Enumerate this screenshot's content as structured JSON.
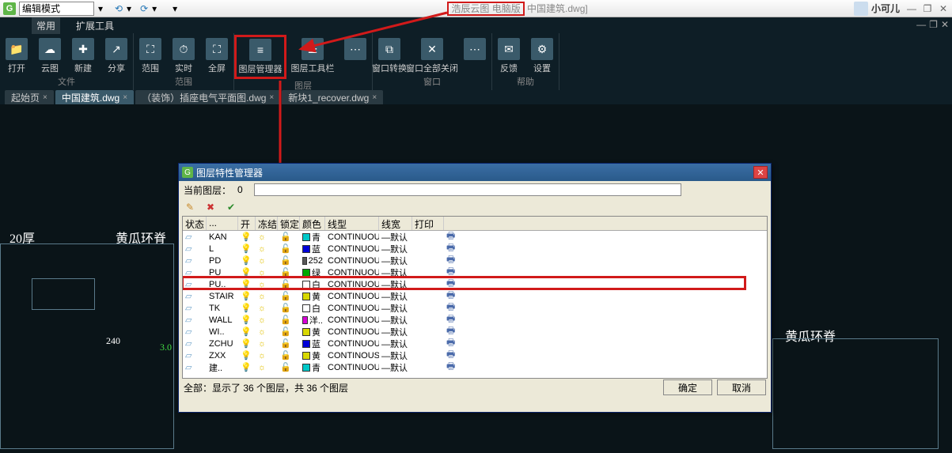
{
  "title": {
    "mode": "编辑模式",
    "center_highlight": "浩辰云图 电脑版",
    "center_suffix": "中国建筑.dwg]",
    "user": "小可儿"
  },
  "menu": {
    "items": [
      "常用",
      "扩展工具"
    ]
  },
  "ribbon": {
    "groups": [
      {
        "label": "文件",
        "buttons": [
          {
            "k": "open",
            "t": "打开"
          },
          {
            "k": "cloud",
            "t": "云图"
          },
          {
            "k": "new",
            "t": "新建"
          },
          {
            "k": "share",
            "t": "分享"
          }
        ]
      },
      {
        "label": "范围",
        "buttons": [
          {
            "k": "extent",
            "t": "范围"
          },
          {
            "k": "realtime",
            "t": "实时"
          },
          {
            "k": "full",
            "t": "全屏"
          }
        ]
      },
      {
        "label": "图层",
        "buttons": [
          {
            "k": "layermgr",
            "t": "图层管理器",
            "hl": true
          },
          {
            "k": "layertool",
            "t": "图层工具栏"
          },
          {
            "k": "layermisc",
            "t": ""
          }
        ]
      },
      {
        "label": "窗口",
        "buttons": [
          {
            "k": "winswitch",
            "t": "窗口转换"
          },
          {
            "k": "winclose",
            "t": "窗口全部关闭"
          },
          {
            "k": "winmisc",
            "t": ""
          }
        ]
      },
      {
        "label": "帮助",
        "buttons": [
          {
            "k": "feedback",
            "t": "反馈"
          },
          {
            "k": "settings",
            "t": "设置"
          }
        ]
      }
    ]
  },
  "tabs": [
    {
      "t": "起始页",
      "active": false
    },
    {
      "t": "中国建筑.dwg",
      "active": true
    },
    {
      "t": "（装饰）插座电气平面图.dwg",
      "active": false
    },
    {
      "t": "新块1_recover.dwg",
      "active": false
    }
  ],
  "drawing": {
    "t1": "20厚",
    "t2": "黄瓜环脊",
    "t3": "240",
    "t4": "3.0",
    "t5": "黄瓜环脊"
  },
  "dialog": {
    "title": "图层特性管理器",
    "current_label": "当前图层：",
    "current_value": "0",
    "headers": {
      "status": "状态",
      "name": "...",
      "on": "开",
      "freeze": "冻结",
      "lock": "锁定",
      "color": "颜色",
      "ltype": "线型",
      "lwt": "线宽",
      "plot": "打印"
    },
    "rows": [
      {
        "n": "KAN",
        "c": "青",
        "ch": "#00c8c8",
        "lt": "CONTINUOUS",
        "lw": "—默认"
      },
      {
        "n": "L",
        "c": "蓝",
        "ch": "#0000d8",
        "lt": "CONTINUOUS",
        "lw": "—默认"
      },
      {
        "n": "PD",
        "c": "252",
        "ch": "#585858",
        "lt": "CONTINUOUS",
        "lw": "—默认"
      },
      {
        "n": "PU",
        "c": "绿",
        "ch": "#00a800",
        "lt": "CONTINUOUS",
        "lw": "—默认"
      },
      {
        "n": "PU..",
        "c": "白",
        "ch": "#ffffff",
        "lt": "CONTINUOUS",
        "lw": "—默认",
        "hl": true
      },
      {
        "n": "STAIR",
        "c": "黄",
        "ch": "#d8d800",
        "lt": "CONTINUOUS",
        "lw": "—默认"
      },
      {
        "n": "TK",
        "c": "白",
        "ch": "#ffffff",
        "lt": "CONTINUOUS",
        "lw": "—默认"
      },
      {
        "n": "WALL",
        "c": "洋..",
        "ch": "#d800d8",
        "lt": "CONTINUOUS",
        "lw": "—默认"
      },
      {
        "n": "WI..",
        "c": "黄",
        "ch": "#d8d800",
        "lt": "CONTINUOUS",
        "lw": "—默认"
      },
      {
        "n": "ZCHU",
        "c": "蓝",
        "ch": "#0000d8",
        "lt": "CONTINUOUS",
        "lw": "—默认"
      },
      {
        "n": "ZXX",
        "c": "黄",
        "ch": "#d8d800",
        "lt": "CONTINOUS",
        "lw": "—默认"
      },
      {
        "n": "建..",
        "c": "青",
        "ch": "#00c8c8",
        "lt": "CONTINUOUS",
        "lw": "—默认"
      }
    ],
    "status_text": "全部：显示了 36 个图层，共 36 个图层",
    "ok": "确定",
    "cancel": "取消"
  }
}
